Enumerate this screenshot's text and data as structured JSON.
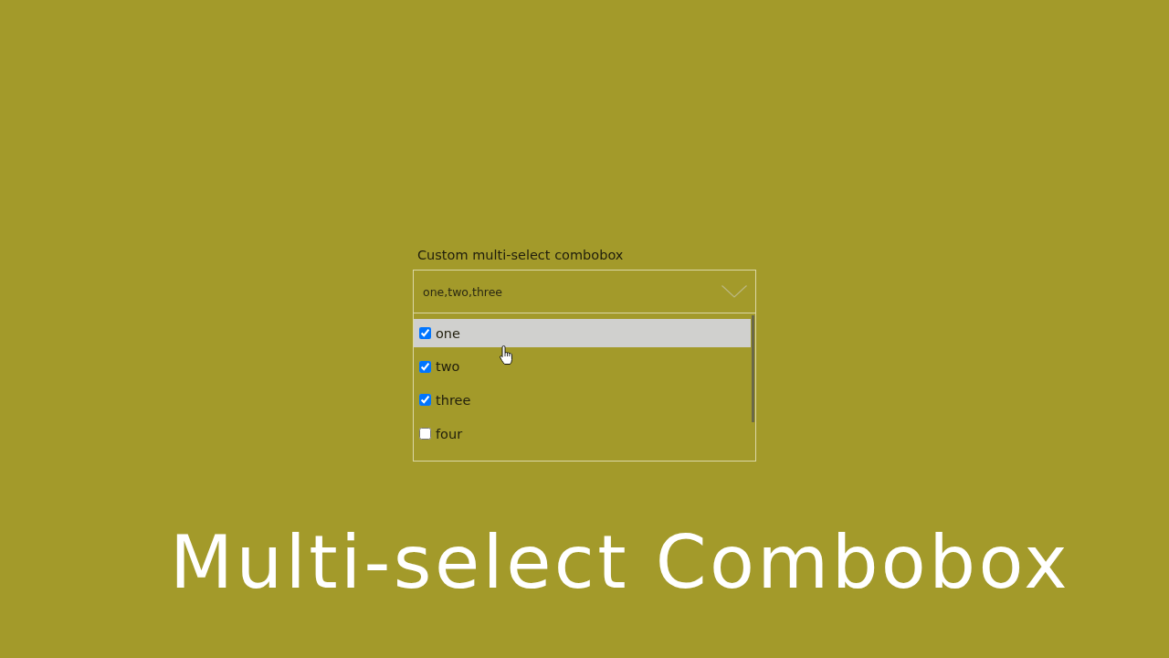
{
  "combobox": {
    "label": "Custom multi-select combobox",
    "value": "one,two,three",
    "expanded": true,
    "items": [
      {
        "label": "one",
        "checked": true,
        "highlighted": true
      },
      {
        "label": "two",
        "checked": true,
        "highlighted": false
      },
      {
        "label": "three",
        "checked": true,
        "highlighted": false
      },
      {
        "label": "four",
        "checked": false,
        "highlighted": false
      }
    ]
  },
  "caption": {
    "title": "Multi-select Combobox"
  }
}
